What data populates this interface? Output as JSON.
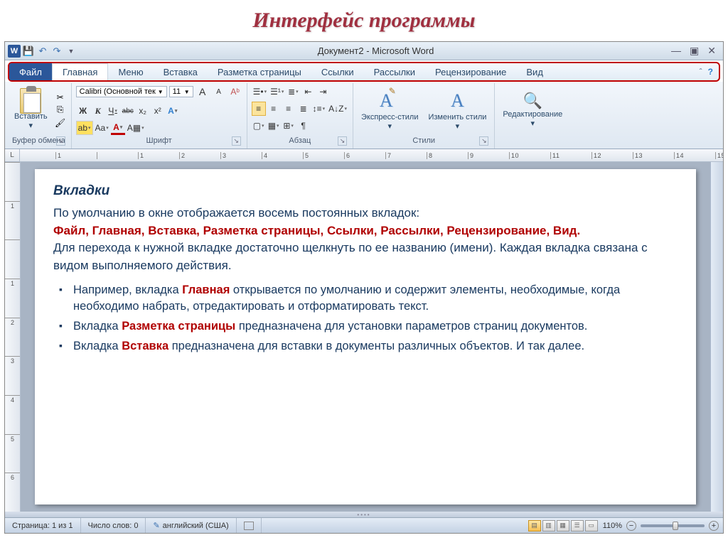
{
  "slide_title": "Интерфейс программы",
  "titlebar": {
    "text": "Документ2 - Microsoft Word"
  },
  "tabs": {
    "file": "Файл",
    "home": "Главная",
    "menu": "Меню",
    "insert": "Вставка",
    "layout": "Разметка страницы",
    "references": "Ссылки",
    "mailings": "Рассылки",
    "review": "Рецензирование",
    "view": "Вид"
  },
  "ribbon": {
    "clipboard": {
      "label": "Буфер обмена",
      "paste": "Вставить"
    },
    "font": {
      "label": "Шрифт",
      "name": "Calibri (Основной тек",
      "size": "11",
      "bold": "Ж",
      "italic": "К",
      "underline": "Ч",
      "strike": "abc",
      "sub": "x₂",
      "sup": "x²",
      "grow": "A",
      "shrink": "A",
      "case": "Aa",
      "clear": "A",
      "color": "A",
      "hl": "A"
    },
    "paragraph": {
      "label": "Абзац"
    },
    "styles": {
      "label": "Стили",
      "quick": "Экспресс-стили",
      "change": "Изменить стили"
    },
    "editing": {
      "label": "Редактирование"
    }
  },
  "doc": {
    "heading": "Вкладки",
    "p1a": "По умолчанию в окне отображается восемь постоянных вкладок:",
    "p1b": "Файл,   Главная,   Вставка,   Разметка страницы,   Ссылки,   Рассылки,   Рецензирование,   Вид.",
    "p2": "Для перехода к нужной вкладке достаточно щелкнуть по ее названию (имени). Каждая вкладка связана с видом выполняемого действия.",
    "li1a": "Например, вкладка ",
    "li1b": "Главная",
    "li1c": " открывается по умолчанию  и содержит элементы, необходимые, когда необходимо набрать, отредактировать и отформатировать текст.",
    "li2a": "Вкладка ",
    "li2b": "Разметка страницы",
    "li2c": " предназначена для установки параметров страниц документов.",
    "li3a": " Вкладка ",
    "li3b": "Вставка",
    "li3c": " предназначена для вставки в документы различных объектов. И так далее."
  },
  "status": {
    "page": "Страница: 1 из 1",
    "words": "Число слов: 0",
    "lang": "английский (США)",
    "zoom": "110%"
  },
  "ruler": {
    "h": [
      "1",
      "",
      "1",
      "2",
      "3",
      "4",
      "5",
      "6",
      "7",
      "8",
      "9",
      "10",
      "11",
      "12",
      "13",
      "14",
      "15"
    ],
    "v": [
      "",
      "1",
      "",
      "1",
      "2",
      "3",
      "4",
      "5",
      "6"
    ]
  }
}
